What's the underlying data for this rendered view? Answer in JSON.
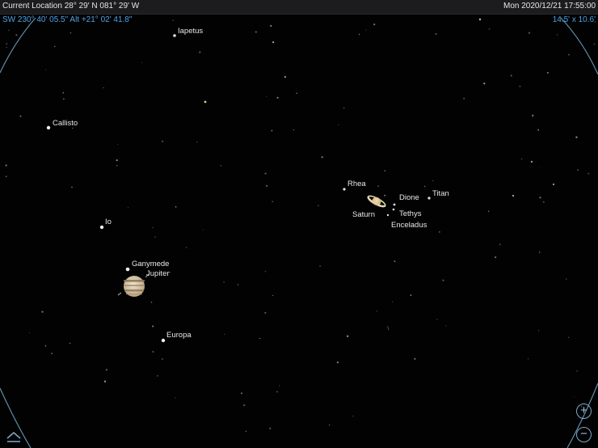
{
  "header": {
    "location": "Current Location  28° 29' N 081° 29' W",
    "datetime": "Mon 2020/12/21  17:55:00"
  },
  "pointing": {
    "coords": "SW 230° 40' 05.5\" Alt +21° 02' 41.8\"",
    "fov": "14.5' x 10.6'"
  },
  "objects": {
    "iapetus": "Iapetus",
    "callisto": "Callisto",
    "io": "Io",
    "ganymede": "Ganymede",
    "jupiter": "Jupiter",
    "europa": "Europa",
    "rhea": "Rhea",
    "dione": "Dione",
    "titan": "Titan",
    "saturn": "Saturn",
    "tethys": "Tethys",
    "enceladus": "Enceladus"
  },
  "controls": {
    "zoom_in_icon": "plus-circle-icon",
    "zoom_out_icon": "minus-circle-icon",
    "up_icon": "chevron-up-icon"
  },
  "colors": {
    "sky": "#020203",
    "accent": "#4da3e6",
    "label": "#e8e8e8",
    "horizon_arc": "#5f8fa8"
  }
}
